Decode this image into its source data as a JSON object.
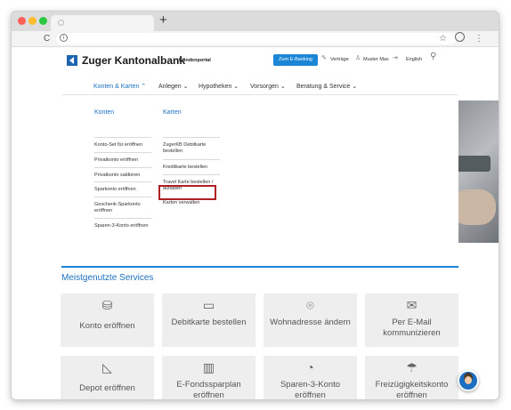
{
  "browser": {
    "new_tab": "+",
    "icons": [
      "back-icon",
      "reload-icon",
      "info-icon",
      "bookmark-star-icon",
      "profile-icon",
      "menu-dots-icon"
    ],
    "colors": {
      "close": "#fe5f57",
      "minimize": "#febc2e",
      "maximize": "#28c840"
    }
  },
  "header": {
    "brand": "Zuger Kantonalbank",
    "portal": "Kundenportal",
    "ebanking": "Zum E-Banking",
    "contracts": "Verträge",
    "user": "Muster Max",
    "language": "English",
    "accent": "#1b86d6"
  },
  "nav": {
    "items": [
      {
        "label": "Konten & Karten ⌃"
      },
      {
        "label": "Anlegen ⌄"
      },
      {
        "label": "Hypotheken ⌄"
      },
      {
        "label": "Vorsorgen ⌄"
      },
      {
        "label": "Beratung & Service ⌄"
      }
    ]
  },
  "menu": {
    "col1": {
      "title": "Konten",
      "items": [
        {
          "label": "Konto-Set für eröffnen"
        },
        {
          "label": "Privatkonto eröffnen"
        },
        {
          "label": "Privatkonto saldieren"
        },
        {
          "label": "Sparkonto eröffnen"
        },
        {
          "label": "Geschenk-Sparkonto eröffnen"
        },
        {
          "label": "Sparen-3-Konto eröffnen"
        }
      ]
    },
    "col2": {
      "title": "Karten",
      "items": [
        {
          "label": "ZugerKB Debitkarte bestellen"
        },
        {
          "label": "Kreditkarte bestellen"
        },
        {
          "label": "Travel Karte bestellen / aufladen"
        },
        {
          "label": "Karten verwalten"
        }
      ]
    },
    "highlight_color": "#b01f24"
  },
  "services": {
    "title": "Meistgenutzte Services",
    "cards": [
      {
        "label": "Konto eröffnen",
        "icon": "coins-icon"
      },
      {
        "label": "Debitkarte bestellen",
        "icon": "card-icon"
      },
      {
        "label": "Wohnadresse ändern",
        "icon": "location-pin-icon"
      },
      {
        "label": "Per E-Mail kommunizieren",
        "icon": "mail-icon"
      },
      {
        "label": "Depot eröffnen",
        "icon": "area-chart-icon"
      },
      {
        "label": "E-Fondssparplan eröffnen",
        "icon": "bar-chart-icon"
      },
      {
        "label": "Sparen-3-Konto eröffnen",
        "icon": "piggy-bank-icon"
      },
      {
        "label": "Freizügigkeitskonto eröffnen",
        "icon": "umbrella-icon"
      }
    ]
  }
}
